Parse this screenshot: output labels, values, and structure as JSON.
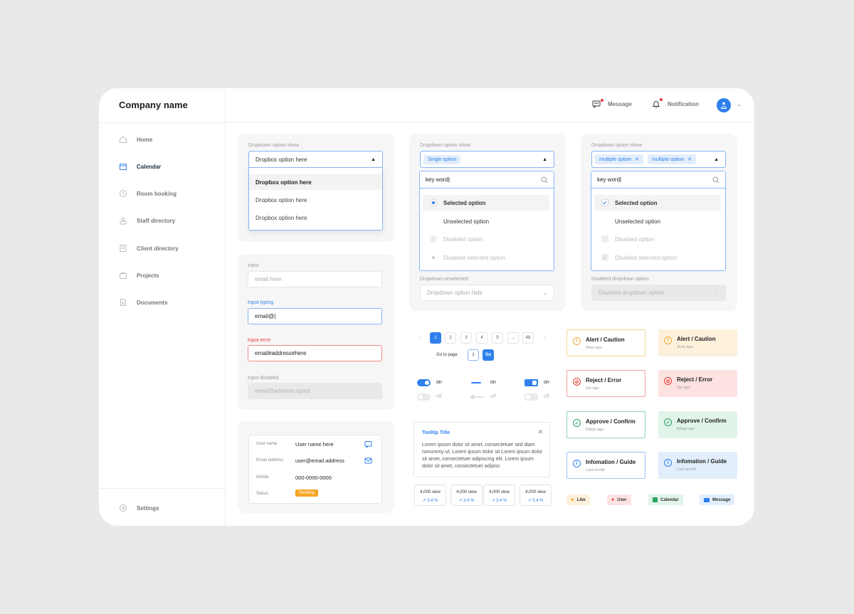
{
  "brand": "Company name",
  "nav": [
    {
      "label": "Home",
      "icon": "home-icon"
    },
    {
      "label": "Calendar",
      "icon": "calendar-icon"
    },
    {
      "label": "Room booking",
      "icon": "clock-icon"
    },
    {
      "label": "Staff directory",
      "icon": "staff-icon"
    },
    {
      "label": "Client directory",
      "icon": "building-icon"
    },
    {
      "label": "Projects",
      "icon": "briefcase-icon"
    },
    {
      "label": "Documents",
      "icon": "document-icon"
    }
  ],
  "settings": "Settings",
  "topbar": {
    "message": "Message",
    "notification": "Notification"
  },
  "dropdown1": {
    "label": "Dropdown option show",
    "value": "Dropbox option here",
    "options": [
      "Dropbox option here",
      "Dropbox option here",
      "Dropbox option here"
    ]
  },
  "dropdown2": {
    "label": "Dropdown option show",
    "tag": "Single option",
    "search": "key word",
    "options": [
      "Selected option",
      "Unselected option",
      "Disabled option",
      "Disabled selected option"
    ],
    "unselected_label": "Dropdown unselected",
    "unselected_value": "Dropdown option hide"
  },
  "dropdown3": {
    "label": "Dropdown option show",
    "tags": [
      "multiple option",
      "multiple option"
    ],
    "search": "key word",
    "options": [
      "Selected option",
      "Unselected option",
      "Disabled option",
      "Disabled selected option"
    ],
    "disabled_label": "Disabled dropdown option",
    "disabled_value": "Disabled dropdown option"
  },
  "inputs": {
    "input_label": "Input",
    "input_placeholder": "email here",
    "typing_label": "Input typing",
    "typing_value": "email@|",
    "error_label": "Input error",
    "error_value": "email#address#here",
    "disabled_label": "Input disabled",
    "disabled_value": "email@address.typed"
  },
  "details": [
    {
      "key": "User name",
      "value": "User name here"
    },
    {
      "key": "Email address",
      "value": "user@email.address"
    },
    {
      "key": "Mobile",
      "value": "000-0000-0000"
    },
    {
      "key": "Status",
      "value": "Pending"
    }
  ],
  "pagination": {
    "prev": "‹",
    "pages": [
      "1",
      "2",
      "3",
      "4",
      "5",
      "...",
      "48"
    ],
    "next": "›",
    "goto_label": "Go to page",
    "goto_value": "1",
    "go": "Go"
  },
  "toggles": {
    "on": "on",
    "off": "off"
  },
  "tooltip": {
    "title": "Tooltip Title",
    "body": "Lorem ipsum dolor sit amet, consectetuer sed diam nonummy ut. Lorem ipsum dolor sit Lorem ipsum dolor sit amet, consectetuer adipiscing elit, Lorem ipsum dolor sit amet, consectetuer adipisc"
  },
  "stats": [
    {
      "value": "4,000 view",
      "pct": "↗ 3.4 %"
    },
    {
      "value": "4,000 view",
      "pct": "↗ 3.4 %"
    },
    {
      "value": "4,000 view",
      "pct": "↗ 3.4 %"
    },
    {
      "value": "4,000 view",
      "pct": "↗ 3.4 %"
    }
  ],
  "alerts": [
    {
      "title": "Alert / Caution",
      "sub": "3min ago",
      "color": "#f2a93b",
      "icon": "!"
    },
    {
      "title": "Reject / Error",
      "sub": "1hr ago",
      "color": "#e53935",
      "icon": "⊘"
    },
    {
      "title": "Approve / Confirm",
      "sub": "5days ago",
      "color": "#27a35f",
      "icon": "✓"
    },
    {
      "title": "Infomation / Guide",
      "sub": "Last month",
      "color": "#2f80ed",
      "icon": "i"
    }
  ],
  "chips": [
    {
      "label": "Like",
      "icon": "heart-icon"
    },
    {
      "label": "User",
      "icon": "user-icon"
    },
    {
      "label": "Calendar",
      "icon": "calendar-icon"
    },
    {
      "label": "Message",
      "icon": "message-icon"
    }
  ],
  "colors": {
    "accent": "#2f80ed",
    "error": "#e53935",
    "warning": "#f2a93b",
    "success": "#27a35f",
    "pending": "#f5a623"
  }
}
